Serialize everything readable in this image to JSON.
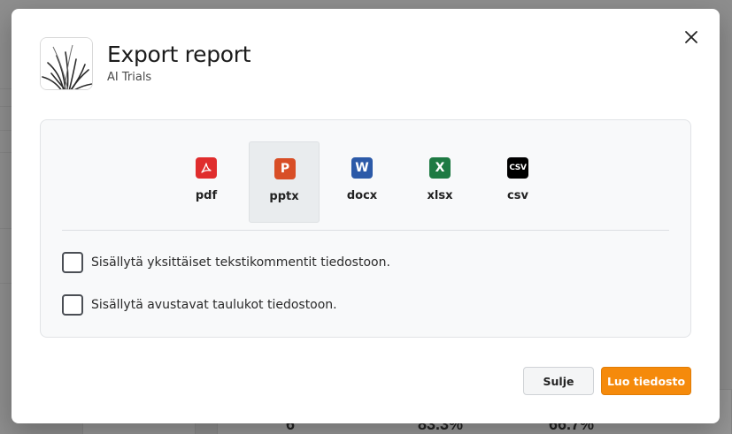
{
  "background": {
    "stats": [
      "6",
      "83.3%",
      "66.7%"
    ]
  },
  "dialog": {
    "title": "Export report",
    "subtitle": "AI Trials",
    "close_icon": "close-icon",
    "formats": [
      {
        "id": "pdf",
        "label": "pdf",
        "icon": "pdf-icon",
        "glyph": "",
        "color": "#e02d2d",
        "selected": false
      },
      {
        "id": "pptx",
        "label": "pptx",
        "icon": "powerpoint-icon",
        "glyph": "P",
        "color": "#d84e26",
        "selected": true
      },
      {
        "id": "docx",
        "label": "docx",
        "icon": "word-icon",
        "glyph": "W",
        "color": "#2c5aa8",
        "selected": false
      },
      {
        "id": "xlsx",
        "label": "xlsx",
        "icon": "excel-icon",
        "glyph": "X",
        "color": "#1e7a43",
        "selected": false
      },
      {
        "id": "csv",
        "label": "csv",
        "icon": "csv-icon",
        "glyph": "CSV",
        "color": "#000000",
        "selected": false
      }
    ],
    "options": [
      {
        "label": "Sisällytä yksittäiset tekstikommentit tiedostoon.",
        "checked": false
      },
      {
        "label": "Sisällytä avustavat taulukot tiedostoon.",
        "checked": false
      }
    ],
    "buttons": {
      "close_label": "Sulje",
      "create_label": "Luo tiedosto"
    },
    "colors": {
      "accent": "#f58a0b",
      "selected_bg": "#e9ecee"
    }
  }
}
